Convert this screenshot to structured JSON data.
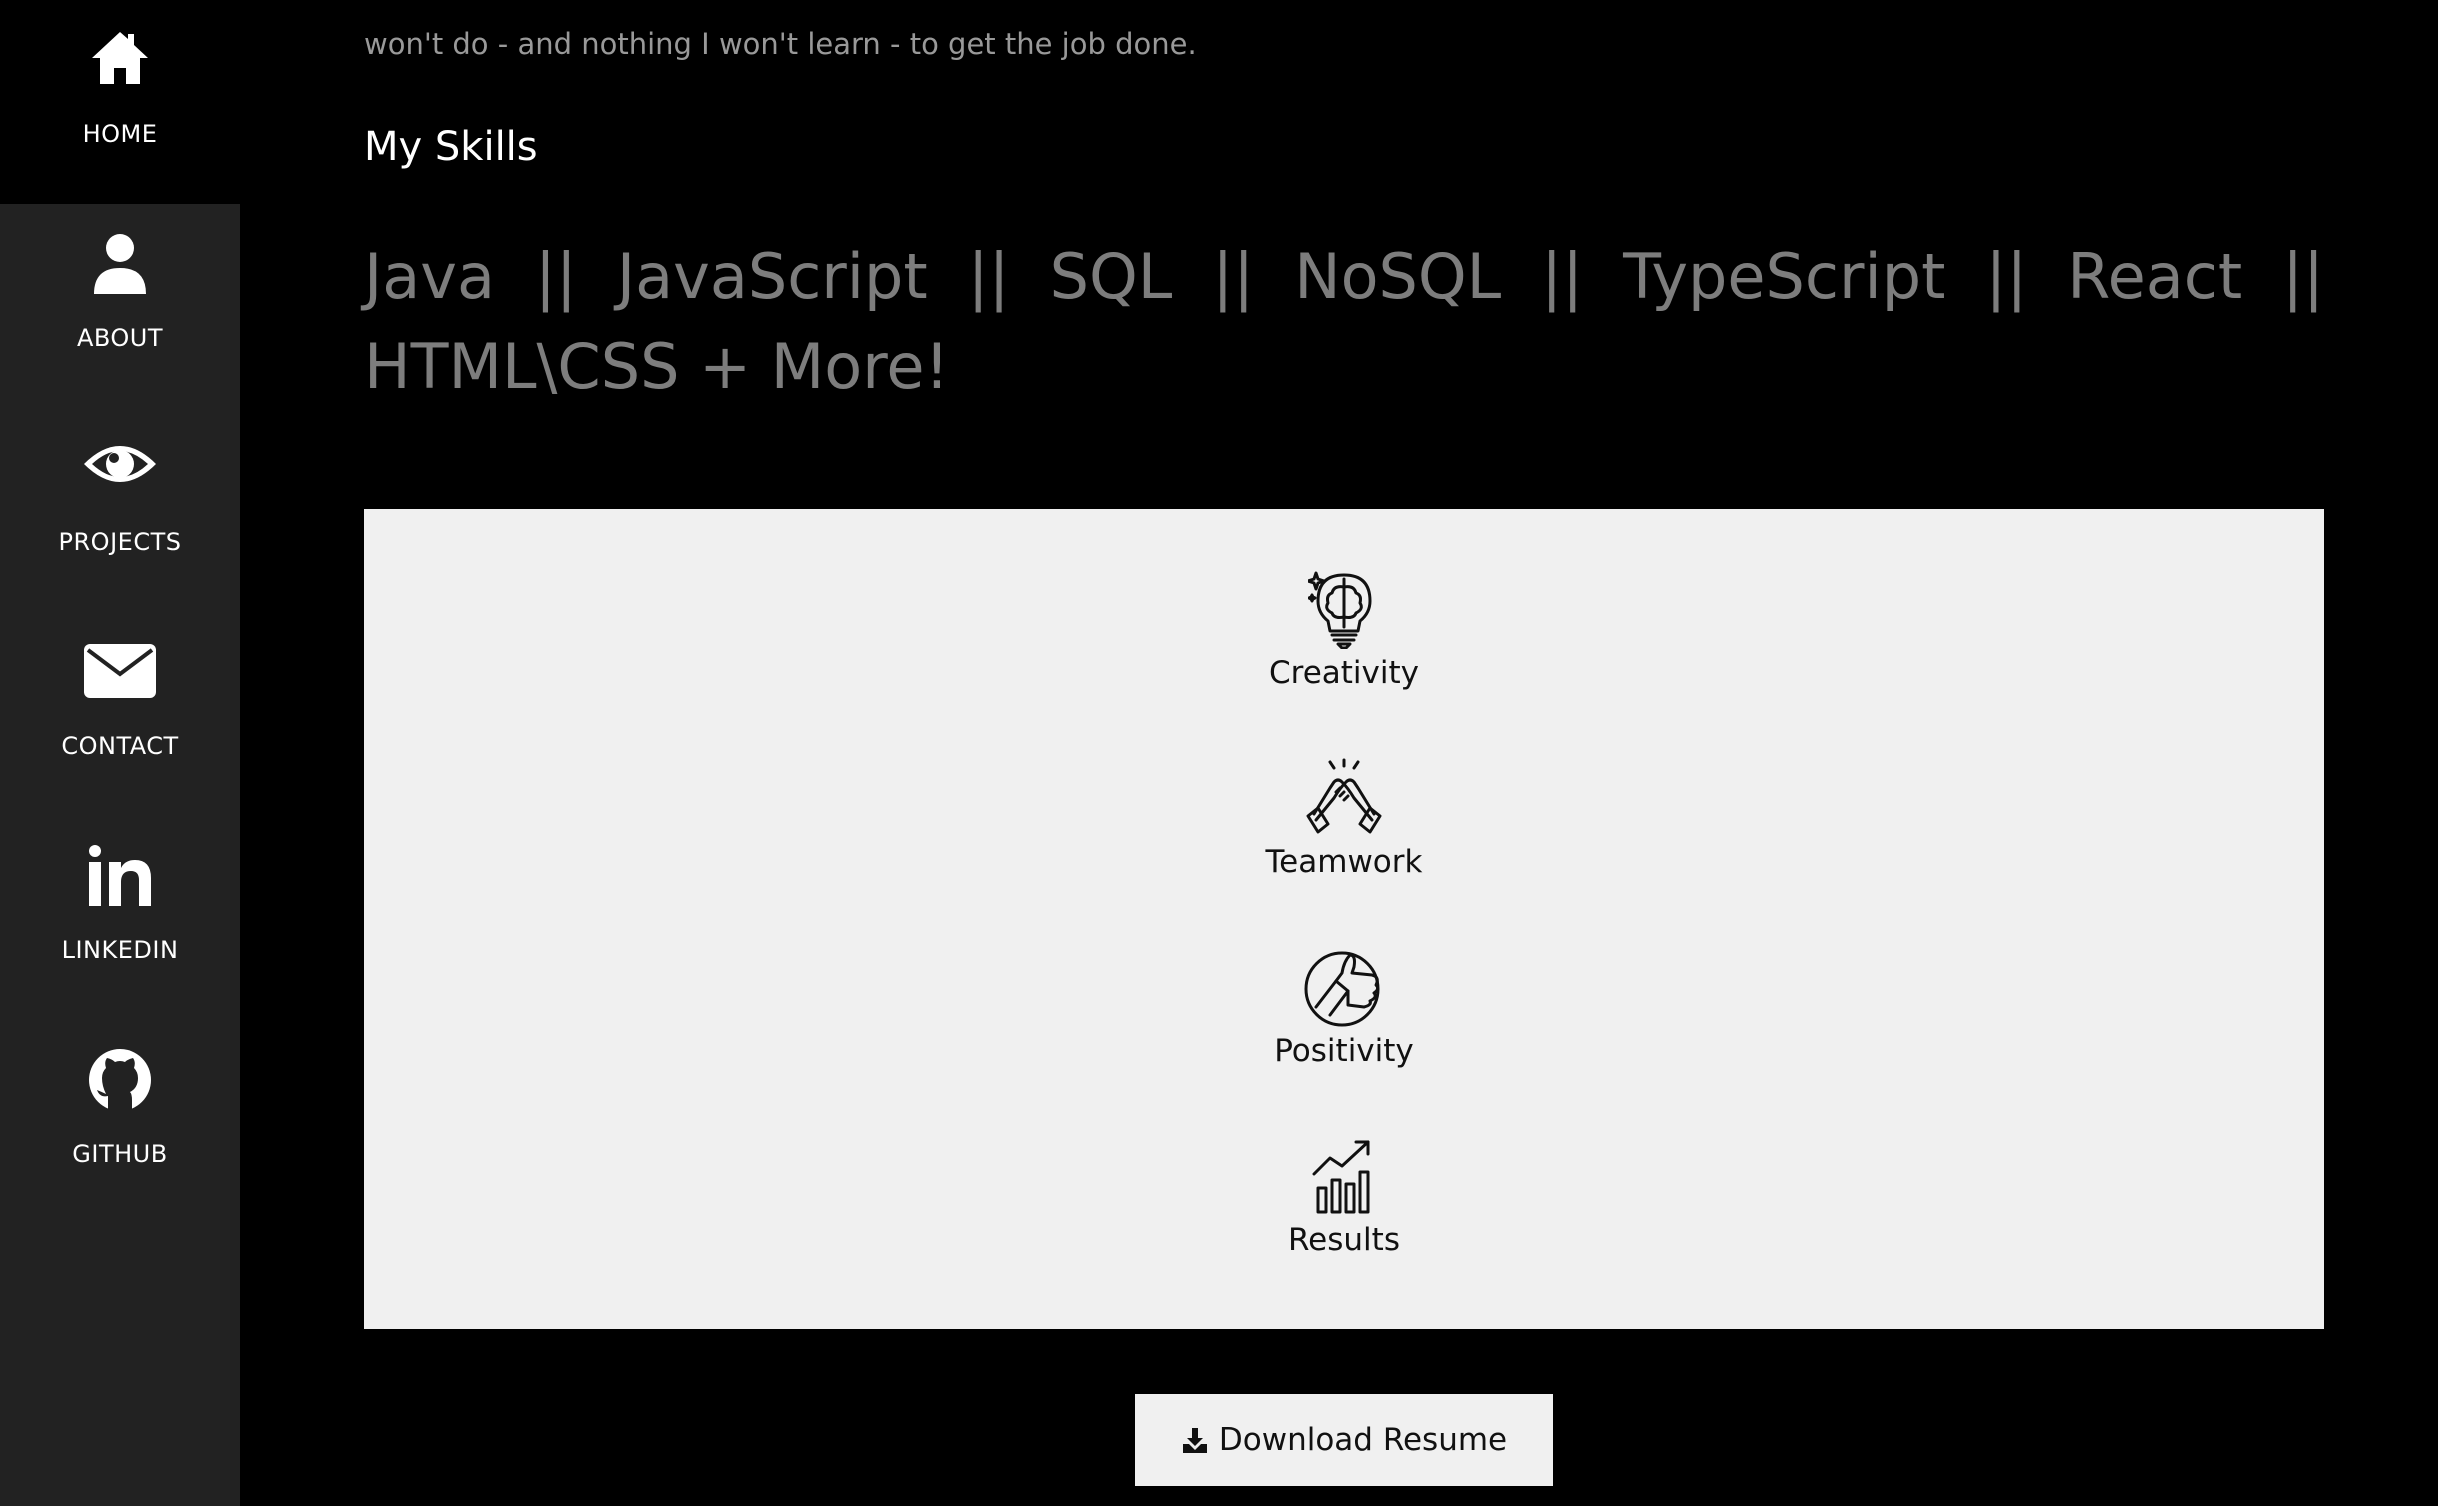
{
  "nav": {
    "items": [
      {
        "label": "HOME",
        "icon": "home-icon",
        "active": true
      },
      {
        "label": "ABOUT",
        "icon": "user-icon",
        "active": false
      },
      {
        "label": "PROJECTS",
        "icon": "eye-icon",
        "active": false
      },
      {
        "label": "CONTACT",
        "icon": "envelope-icon",
        "active": false
      },
      {
        "label": "LINKEDIN",
        "icon": "linkedin-icon",
        "active": false
      },
      {
        "label": "GITHUB",
        "icon": "github-icon",
        "active": false
      }
    ]
  },
  "intro": {
    "partial_text": "won't do - and nothing I won't learn - to get the job done."
  },
  "skills": {
    "heading": "My Skills",
    "list": "Java || JavaScript || SQL || NoSQL || TypeScript || React || HTML\\CSS + More!"
  },
  "soft_skills": [
    {
      "label": "Creativity",
      "icon": "brain-lightbulb-icon"
    },
    {
      "label": "Teamwork",
      "icon": "handshake-icon"
    },
    {
      "label": "Positivity",
      "icon": "thumbs-up-icon"
    },
    {
      "label": "Results",
      "icon": "growth-chart-icon"
    }
  ],
  "download": {
    "label": "Download Resume",
    "icon": "download-icon"
  },
  "colors": {
    "background": "#000000",
    "sidebar": "#222222",
    "panel": "#f0f0f0",
    "skills_text": "#7d7d7d"
  }
}
